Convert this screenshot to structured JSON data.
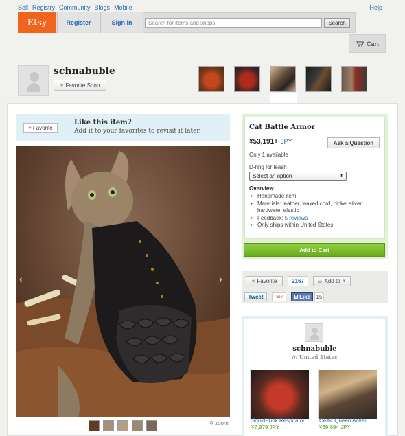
{
  "topnav": {
    "links": [
      "Sell",
      "Registry",
      "Community",
      "Blogs",
      "Mobile"
    ],
    "help": "Help"
  },
  "header": {
    "logo": "Etsy",
    "register": "Register",
    "signin": "Sign In",
    "search_placeholder": "Search for items and shops",
    "search_button": "Search",
    "cart": "Cart"
  },
  "shop": {
    "name": "schnabuble",
    "favorite_shop": "Favorite Shop"
  },
  "favorite_prompt": {
    "button": "Favorite",
    "title": "Like this item?",
    "subtitle": "Add it to your favorites to revisit it later."
  },
  "photo": {
    "zoom": "zoom"
  },
  "item": {
    "title": "Cat Battle Armor",
    "price": "¥53,191+",
    "currency": "JPY",
    "ask_question": "Ask a Question",
    "availability": "Only 1 available",
    "variation_label": "D-ring for leash",
    "variation_selected": "Select an option",
    "overview_title": "Overview",
    "overview": [
      "Handmade item",
      "Materials: leather, waxed cord, nickel silver hardware, elastic",
      "Feedback: ",
      "Only ships within United States."
    ],
    "feedback_link": "5 reviews",
    "add_to_cart": "Add to Cart"
  },
  "social": {
    "favorite": "Favorite",
    "favorite_count": "2167",
    "add_to": "Add to",
    "tweet": "Tweet",
    "pin": "Pin it",
    "fb_like": "Like",
    "fb_count": "15"
  },
  "seller": {
    "name": "schnabuble",
    "location_prefix": "in",
    "location": "United States",
    "listings": [
      {
        "name": "SquidPunk Respirator",
        "price": "¥7,979 JPY"
      },
      {
        "name": "Celtic Queen Antler...",
        "price": "¥39,894 JPY"
      }
    ]
  },
  "colors": {
    "etsy_orange": "#f1641e",
    "link_blue": "#2a6db5",
    "cart_green": "#7fc232"
  }
}
